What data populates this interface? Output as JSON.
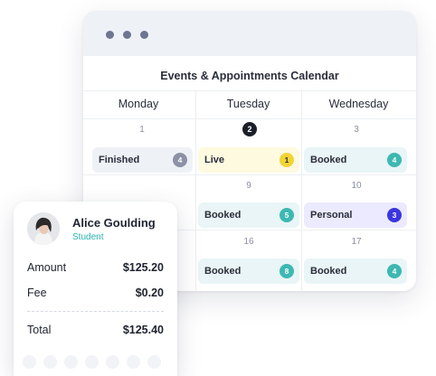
{
  "calendar": {
    "title": "Events & Appointments Calendar",
    "days": [
      "Monday",
      "Tuesday",
      "Wednesday"
    ],
    "dates": {
      "r1c1": "1",
      "r1c2": "2",
      "r1c3": "3",
      "r2c2": "9",
      "r2c3": "10",
      "r3c2": "16",
      "r3c3": "17"
    },
    "events": {
      "mon_1": {
        "label": "Finished",
        "count": "4",
        "color": "#8c91a6"
      },
      "tue_1": {
        "label": "Live",
        "count": "1",
        "color": "#f2d435"
      },
      "wed_1": {
        "label": "Booked",
        "count": "4",
        "color": "#3db8b2"
      },
      "tue_2": {
        "label": "Booked",
        "count": "5",
        "color": "#3db8b2"
      },
      "wed_2": {
        "label": "Personal",
        "count": "3",
        "color": "#3a35e0"
      },
      "tue_3": {
        "label": "Booked",
        "count": "8",
        "color": "#3db8b2"
      },
      "wed_3": {
        "label": "Booked",
        "count": "4",
        "color": "#3db8b2"
      }
    }
  },
  "card": {
    "name": "Alice Goulding",
    "role": "Student",
    "amount_label": "Amount",
    "amount_value": "$125.20",
    "fee_label": "Fee",
    "fee_value": "$0.20",
    "total_label": "Total",
    "total_value": "$125.40"
  },
  "colors": {
    "accent_teal": "#2bb3b3",
    "today_dot": "#1c1f28"
  }
}
